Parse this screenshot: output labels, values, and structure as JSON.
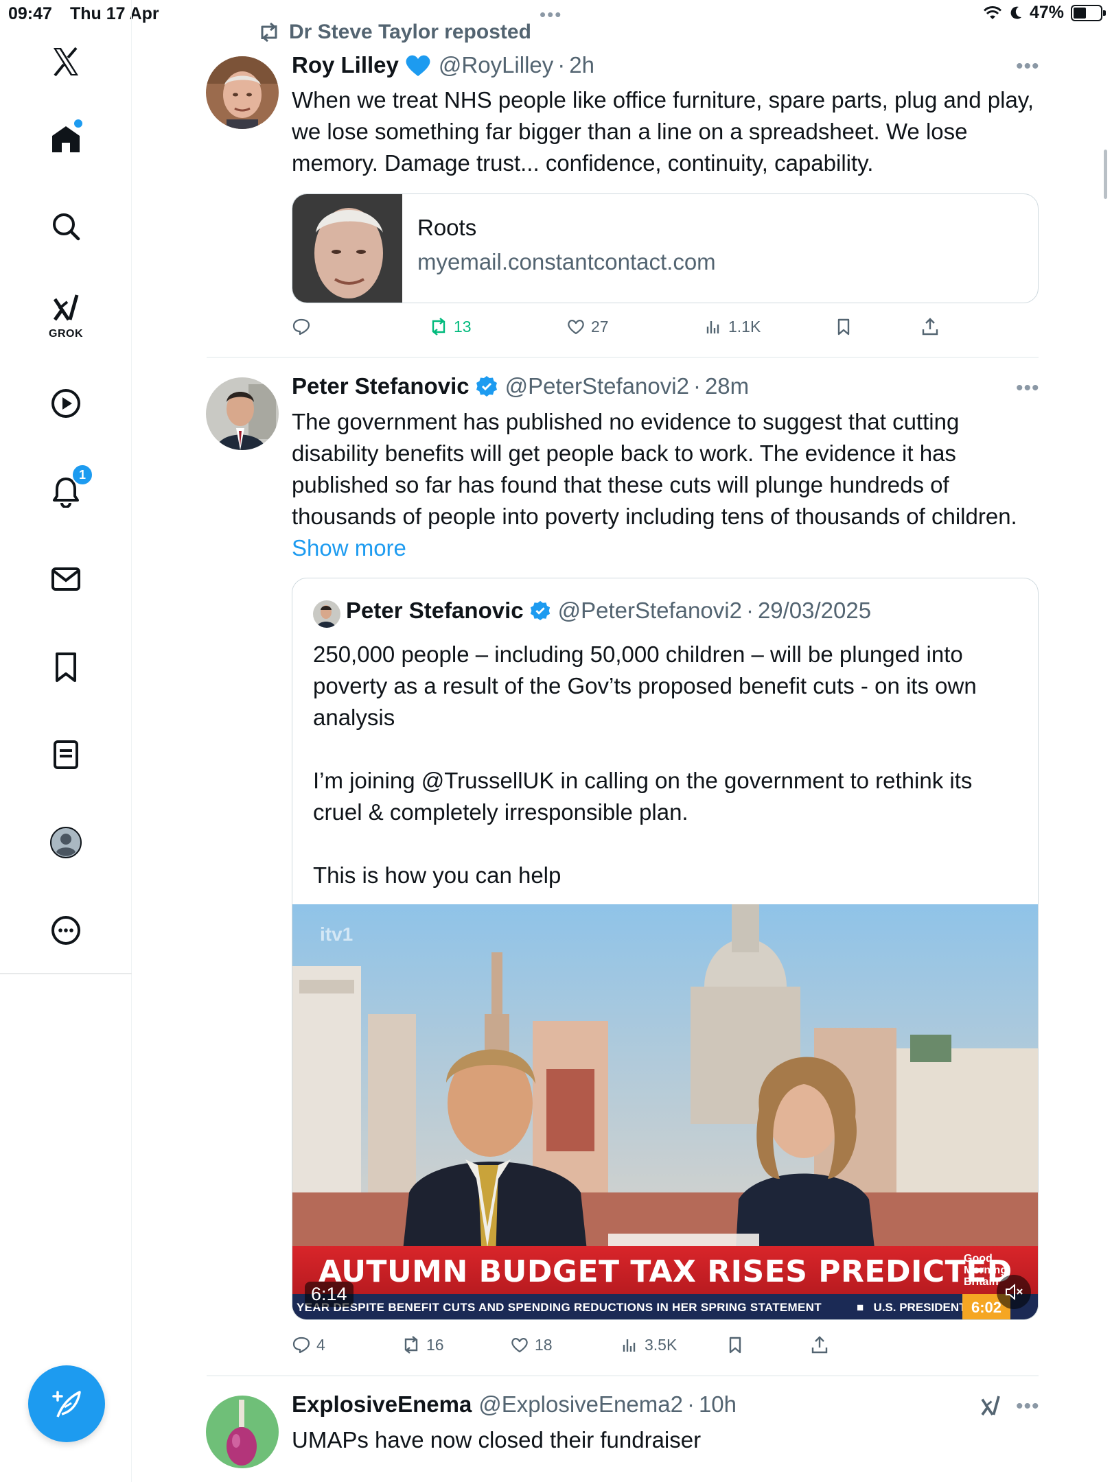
{
  "status_bar": {
    "time": "09:47",
    "date": "Thu 17 Apr",
    "battery_label": "47%",
    "battery_level": 0.47
  },
  "sidebar": {
    "grok_label": "GROK",
    "notifications_count": "1",
    "items": [
      "x-logo",
      "home-icon",
      "search-icon",
      "grok-icon",
      "video-icon",
      "bell-icon",
      "mail-icon",
      "bookmark-icon",
      "list-icon",
      "profile-icon",
      "more-icon"
    ]
  },
  "tweets": [
    {
      "repost_label": "Dr Steve Taylor reposted",
      "name": "Roy Lilley",
      "badge": "blue-heart",
      "handle": "@RoyLilley",
      "time": "2h",
      "text": "When we treat NHS people like office furniture, spare parts, plug and play, we lose something far bigger than a line on a spreadsheet. We lose memory. Damage trust... confidence, continuity, capability.",
      "card": {
        "title": "Roots",
        "domain": "myemail.constantcontact.com"
      },
      "stats": {
        "replies": "",
        "reposts": "13",
        "likes": "27",
        "views": "1.1K"
      }
    },
    {
      "name": "Peter Stefanovic",
      "badge": "verified",
      "handle": "@PeterStefanovi2",
      "time": "28m",
      "text": "The government has published no evidence to suggest that cutting disability benefits will get people back to work. The evidence it has published so far has found that these cuts will plunge hundreds of thousands of people into poverty including tens of thousands of children.",
      "show_more": "Show more",
      "quote": {
        "name": "Peter Stefanovic",
        "handle": "@PeterStefanovi2",
        "date": "29/03/2025",
        "paragraphs": [
          "250,000 people – including 50,000 children – will be plunged into poverty as a result of the Gov’ts proposed benefit cuts - on its own analysis",
          "I’m joining @TrussellUK in calling on the government to rethink its cruel & completely irresponsible plan.",
          "This is how you can help"
        ],
        "video": {
          "duration": "6:14",
          "watermark": "itv1",
          "headline": "AUTUMN BUDGET TAX RISES PREDICTED",
          "logo_lines": [
            "Good",
            "Morning",
            "Britain"
          ],
          "ticker": "YEAR DESPITE BENEFIT CUTS AND SPENDING REDUCTIONS IN HER SPRING STATEMENT",
          "ticker_right": "U.S. PRESIDENT",
          "clock": "6:02"
        }
      },
      "stats": {
        "replies": "4",
        "reposts": "16",
        "likes": "18",
        "views": "3.5K"
      }
    },
    {
      "name": "ExplosiveEnema",
      "handle": "@ExplosiveEnema2",
      "time": "10h",
      "text": "UMAPs have now closed their fundraiser"
    }
  ],
  "colors": {
    "accent": "#1d9bf0",
    "repost_green": "#00ba7c",
    "muted": "#536471",
    "border": "#cfd9de",
    "ticker_red": "#d9252a",
    "ticker_navy": "#1b2a55"
  }
}
